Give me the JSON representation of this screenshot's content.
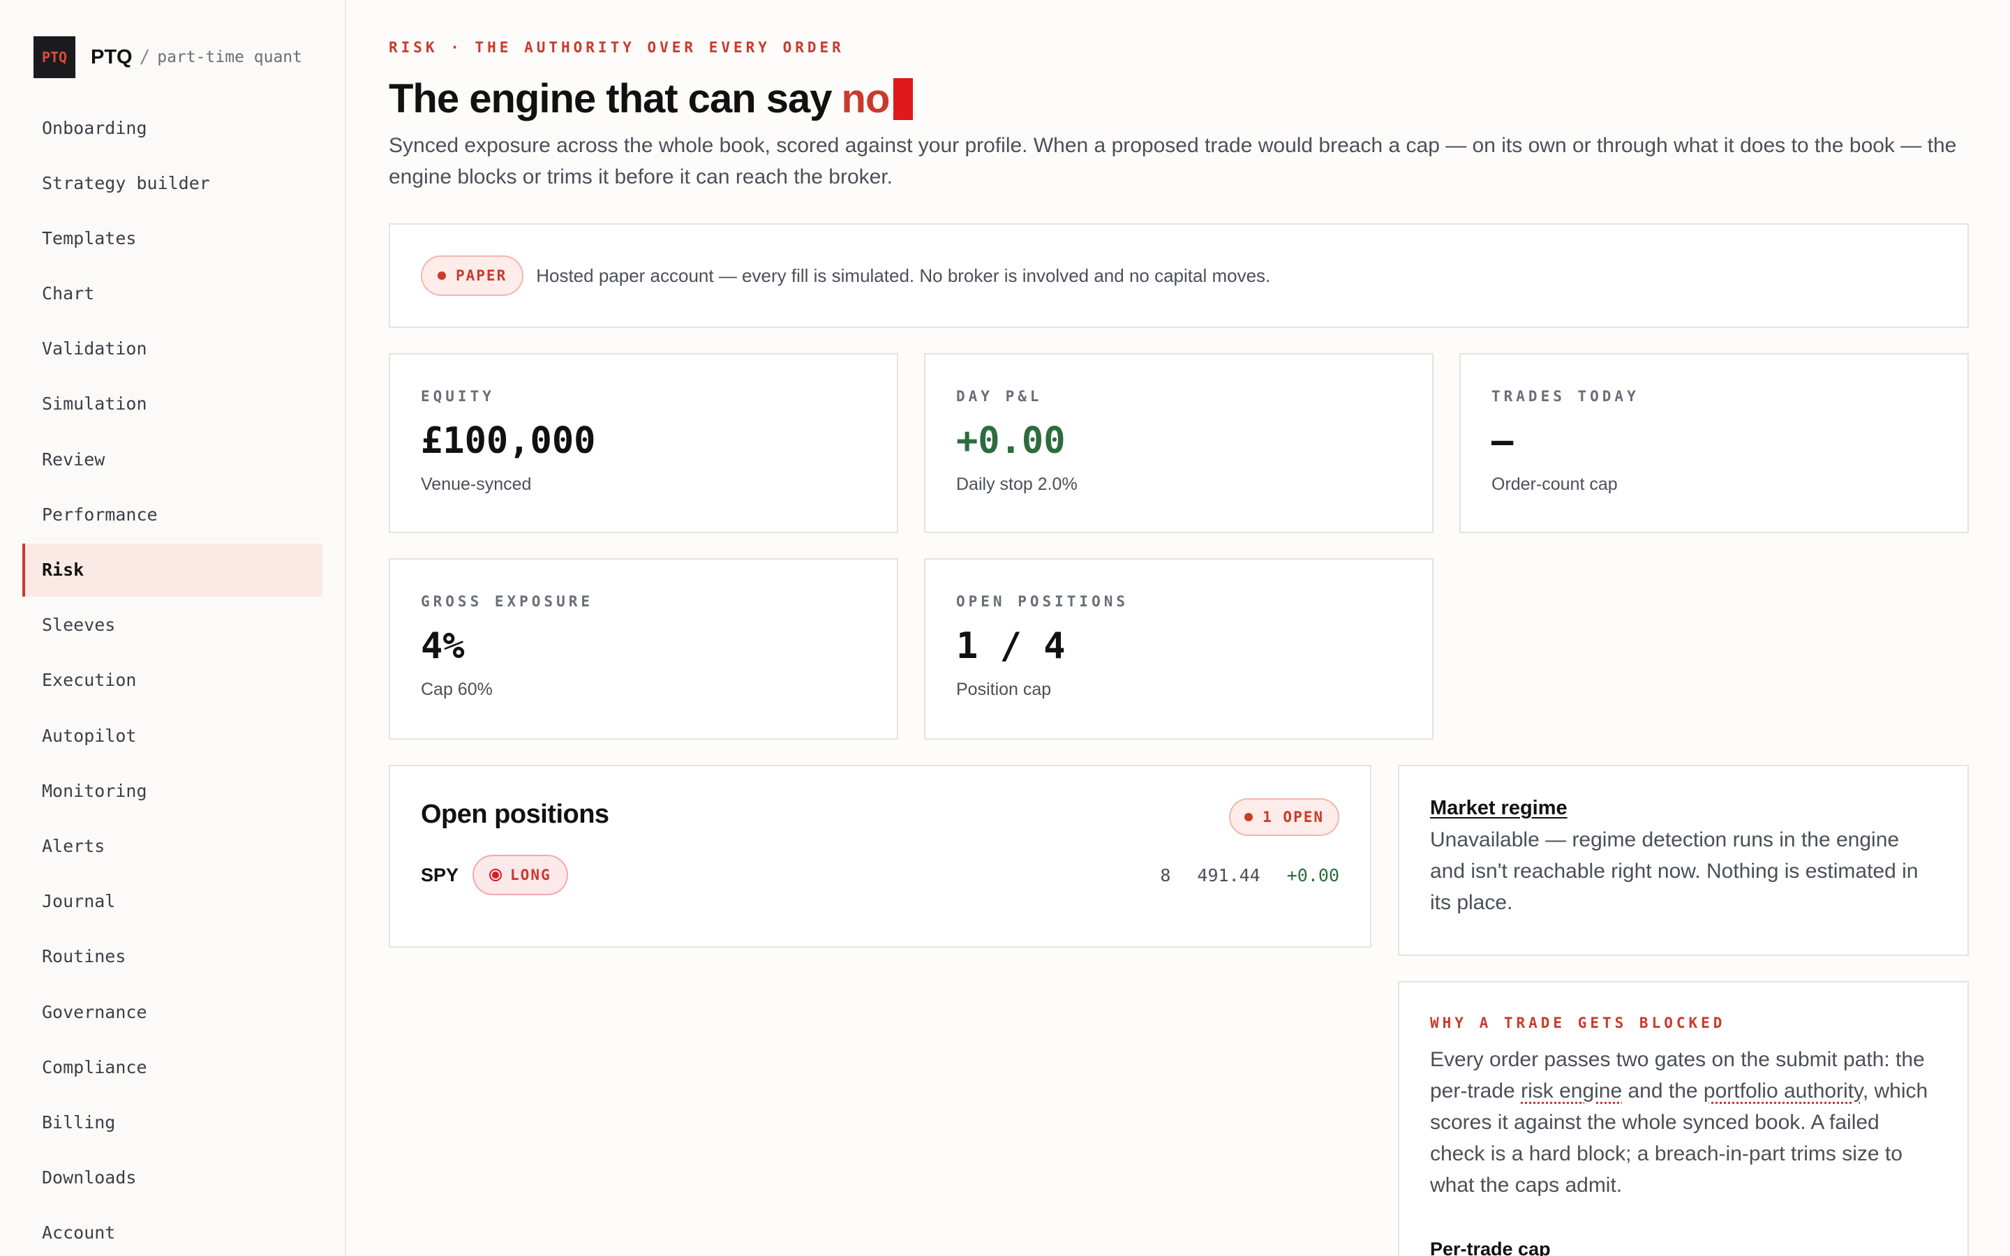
{
  "brand": {
    "logo_text": "PTQ",
    "name": "PTQ",
    "separator": "/",
    "subtitle": "part-time quant"
  },
  "nav": [
    {
      "label": "Onboarding"
    },
    {
      "label": "Strategy builder"
    },
    {
      "label": "Templates"
    },
    {
      "label": "Chart"
    },
    {
      "label": "Validation"
    },
    {
      "label": "Simulation"
    },
    {
      "label": "Review"
    },
    {
      "label": "Performance"
    },
    {
      "label": "Risk",
      "active": true
    },
    {
      "label": "Sleeves"
    },
    {
      "label": "Execution"
    },
    {
      "label": "Autopilot"
    },
    {
      "label": "Monitoring"
    },
    {
      "label": "Alerts"
    },
    {
      "label": "Journal"
    },
    {
      "label": "Routines"
    },
    {
      "label": "Governance"
    },
    {
      "label": "Compliance"
    },
    {
      "label": "Billing"
    },
    {
      "label": "Downloads"
    },
    {
      "label": "Account"
    }
  ],
  "header": {
    "eyebrow": "RISK · THE AUTHORITY OVER EVERY ORDER",
    "title_main": "The engine that can say",
    "title_accent": "no",
    "lede": "Synced exposure across the whole book, scored against your profile. When a proposed trade would breach a cap — on its own or through what it does to the book — the engine blocks or trims it before it can reach the broker."
  },
  "notice": {
    "badge": "PAPER",
    "text": "Hosted paper account — every fill is simulated. No broker is involved and no capital moves."
  },
  "stats": {
    "equity": {
      "label": "EQUITY",
      "value": "£100,000",
      "sub": "Venue-synced"
    },
    "day_pnl": {
      "label": "DAY P&L",
      "value": "+0.00",
      "sub": "Daily stop 2.0%"
    },
    "trades_today": {
      "label": "TRADES TODAY",
      "value": "—",
      "sub": "Order-count cap"
    },
    "gross_exposure": {
      "label": "GROSS EXPOSURE",
      "value": "4%",
      "sub": "Cap 60%"
    },
    "open_positions": {
      "label": "OPEN POSITIONS",
      "value": "1 / 4",
      "sub": "Position cap"
    }
  },
  "positions": {
    "title": "Open positions",
    "badge": "1 OPEN",
    "rows": [
      {
        "symbol": "SPY",
        "side": "LONG",
        "qty": "8",
        "price": "491.44",
        "pnl": "+0.00"
      }
    ]
  },
  "regime": {
    "title": "Market regime",
    "text": "Unavailable — regime detection runs in the engine and isn't reachable right now. Nothing is estimated in its place."
  },
  "why": {
    "eyebrow": "WHY A TRADE GETS BLOCKED",
    "text_1": "Every order passes two gates on the submit path: the per-trade ",
    "link_1": "risk engine",
    "text_2": " and the ",
    "link_2": "portfolio authority",
    "text_3": ", which scores it against the whole synced book. A failed check is a hard block; a breach-in-part trims size to what the caps admit.",
    "subheading": "Per-trade cap"
  },
  "colors": {
    "accent": "#c93a2b",
    "positive": "#2e6b3f",
    "cursor": "#e0191c"
  }
}
